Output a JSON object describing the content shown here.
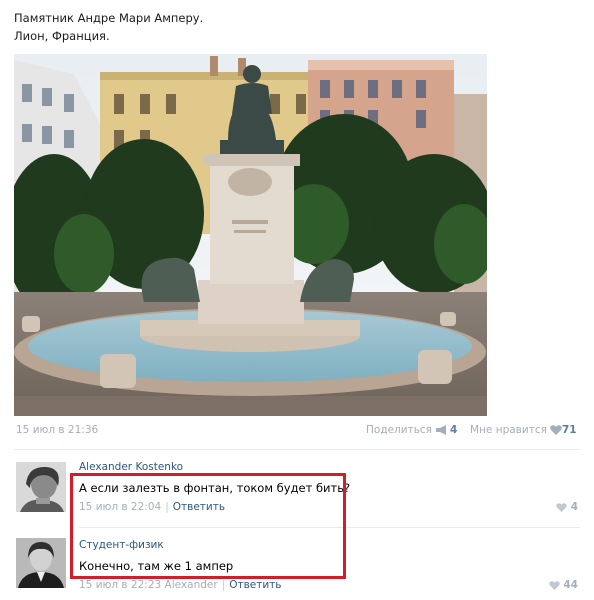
{
  "post": {
    "caption_line1": "Памятник Андре Мари Амперу.",
    "caption_line2": "Лион, Франция.",
    "date": "15 июл в 21:36",
    "share_label": "Поделиться",
    "share_count": "4",
    "like_label": "Мне нравится",
    "like_count": "71"
  },
  "comments": [
    {
      "author": "Alexander Kostenko",
      "text": "А если залезть в фонтан, током будет бить?",
      "date": "15 июл в 22:04",
      "reply_label": "Ответить",
      "likes": "4"
    },
    {
      "author": "Студент-физик",
      "text": "Конечно, там же 1 ампер",
      "date": "15 июл в 22:23",
      "reply_to": "Alexander",
      "reply_label": "Ответить",
      "likes": "44"
    }
  ],
  "icons": {
    "share": "megaphone-icon",
    "like": "heart-icon"
  },
  "colors": {
    "link": "#2b587a",
    "meta": "#a3aebb",
    "highlight": "#d21e2b"
  }
}
